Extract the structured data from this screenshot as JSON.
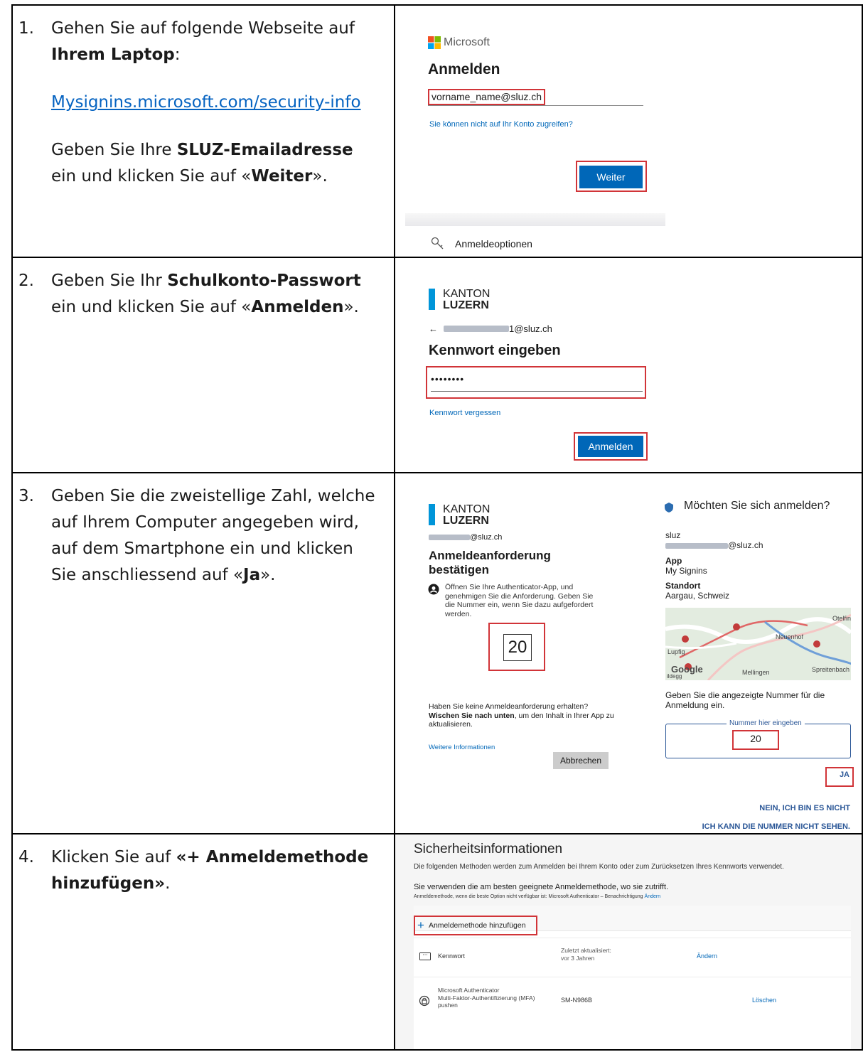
{
  "steps": [
    {
      "number": "1.",
      "line1": "Gehen Sie auf folgende Webseite auf",
      "line2_bold": "Ihrem Laptop",
      "line2_rest": ":",
      "link": "Mysignins.microsoft.com/security-info",
      "p2_a": "Geben Sie Ihre ",
      "p2_b": "SLUZ-Emailadresse",
      "p2_c": " ein und klicken Sie auf «",
      "p2_d": "Weiter",
      "p2_e": "».",
      "screen": {
        "brand": "Microsoft",
        "title": "Anmelden",
        "email": "vorname_name@sluz.ch",
        "no_access": "Sie können nicht auf Ihr Konto zugreifen?",
        "next_button": "Weiter",
        "options": "Anmeldeoptionen"
      }
    },
    {
      "number": "2.",
      "a": "Geben Sie Ihr ",
      "b": "Schulkonto-Passwort",
      "c": " ein und klicken Sie auf «",
      "d": "Anmelden",
      "e": "».",
      "screen": {
        "kanton_1": "KANTON",
        "kanton_2": "LUZERN",
        "email_suffix": "1@sluz.ch",
        "title": "Kennwort eingeben",
        "password": "••••••••",
        "forgot": "Kennwort vergessen",
        "signin_button": "Anmelden"
      }
    },
    {
      "number": "3.",
      "a": "Geben Sie die zweistellige Zahl, welche auf Ihrem Computer angegeben wird, auf dem Smartphone ein und klicken Sie anschliessend auf «",
      "b": "Ja",
      "c": "».",
      "screen": {
        "kanton_1": "KANTON",
        "kanton_2": "LUZERN",
        "email_suffix": "@sluz.ch",
        "title_1": "Anmeldeanforderung",
        "title_2": "bestätigen",
        "instruction": "Öffnen Sie Ihre Authenticator-App, und genehmigen Sie die Anforderung. Geben Sie die Nummer ein, wenn Sie dazu aufgefordert werden.",
        "number": "20",
        "no_request": "Haben Sie keine Anmeldeanforderung erhalten?",
        "swipe_bold": "Wischen Sie nach unten",
        "swipe_rest": ", um den Inhalt in Ihrer App zu aktualisieren.",
        "more_info": "Weitere Informationen",
        "cancel": "Abbrechen",
        "phone_title": "Möchten Sie sich anmelden?",
        "phone_org": "sluz",
        "phone_email_suffix": "@sluz.ch",
        "app_label": "App",
        "app_value": "My Signins",
        "loc_label": "Standort",
        "loc_value": "Aargau, Schweiz",
        "map_labels": [
          "Otelfin",
          "Neuenhof",
          "Lupfig",
          "Spreitenbach",
          "Mellingen",
          "ildegg",
          "Google"
        ],
        "enter_number": "Geben Sie die angezeigte Nummer für die Anmeldung ein.",
        "field_label": "Nummer hier eingeben",
        "field_value": "20",
        "yes": "JA",
        "no": "NEIN, ICH BIN ES NICHT",
        "cant_see": "ICH KANN DIE NUMMER NICHT SEHEN."
      }
    },
    {
      "number": "4.",
      "a": "Klicken Sie auf ",
      "b": "«+ Anmeldemethode hinzufügen»",
      "c": ".",
      "screen": {
        "title": "Sicherheitsinformationen",
        "desc": "Die folgenden Methoden werden zum Anmelden bei Ihrem Konto oder zum Zurücksetzen Ihres Kennworts verwendet.",
        "best": "Sie verwenden die am besten geeignete Anmeldemethode, wo sie zutrifft.",
        "fallback": "Anmeldemethode, wenn die beste Option nicht verfügbar ist: Microsoft Authenticator – Benachrichtigung",
        "fallback_link": "Ändern",
        "add_method": "Anmeldemethode hinzufügen",
        "rows": [
          {
            "name": "Kennwort",
            "updated_label": "Zuletzt aktualisiert:",
            "updated_value": "vor 3 Jahren",
            "action": "Ändern"
          },
          {
            "name": "Microsoft Authenticator",
            "sub1": "Multi-Faktor-Authentifizierung (MFA)",
            "sub2": "pushen",
            "device": "SM-N986B",
            "action": "Löschen"
          }
        ]
      }
    }
  ]
}
